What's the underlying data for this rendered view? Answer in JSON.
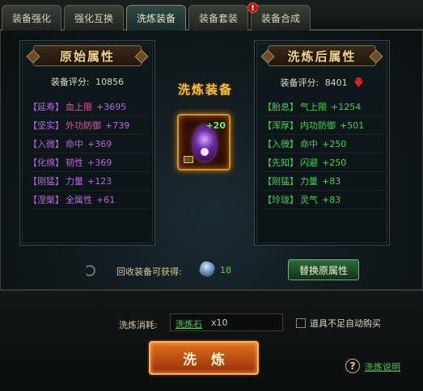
{
  "tabs": [
    {
      "label": "装备强化"
    },
    {
      "label": "强化互换"
    },
    {
      "label": "洗炼装备"
    },
    {
      "label": "装备套装"
    },
    {
      "label": "装备合成"
    }
  ],
  "tab_alert": "!",
  "left_panel": {
    "title": "原始属性",
    "score_label": "装备评分:",
    "score_value": "10856",
    "attrs": [
      {
        "tag": "【延寿】",
        "name": "血上限",
        "value": "+3695"
      },
      {
        "tag": "【坚实】",
        "name": "外功防御",
        "value": "+739"
      },
      {
        "tag": "【入微】",
        "name": "命中",
        "value": "+369"
      },
      {
        "tag": "【化绵】",
        "name": "韧性",
        "value": "+369"
      },
      {
        "tag": "【刚猛】",
        "name": "力量",
        "value": "+123"
      },
      {
        "tag": "【涅槃】",
        "name": "全属性",
        "value": "+61"
      }
    ]
  },
  "right_panel": {
    "title": "洗炼后属性",
    "score_label": "装备评分:",
    "score_value": "8401",
    "attrs": [
      {
        "tag": "【胎息】",
        "name": "气上限",
        "value": "+1254"
      },
      {
        "tag": "【浑厚】",
        "name": "内功防御",
        "value": "+501"
      },
      {
        "tag": "【入微】",
        "name": "命中",
        "value": "+250"
      },
      {
        "tag": "【先知】",
        "name": "闪避",
        "value": "+250"
      },
      {
        "tag": "【刚猛】",
        "name": "力量",
        "value": "+83"
      },
      {
        "tag": "【玲珑】",
        "name": "灵气",
        "value": "+83"
      }
    ]
  },
  "center": {
    "title": "洗炼装备",
    "item_plus": "+20"
  },
  "recover": {
    "label": "回收装备可获得:",
    "count": "18",
    "replace_label": "替换原属性"
  },
  "cost": {
    "label": "洗炼消耗:",
    "item": "洗炼石",
    "qty": "x10"
  },
  "autobuy_label": "道具不足自动购买",
  "refine_label": "洗炼",
  "help": {
    "icon": "?",
    "label": "洗炼说明"
  }
}
